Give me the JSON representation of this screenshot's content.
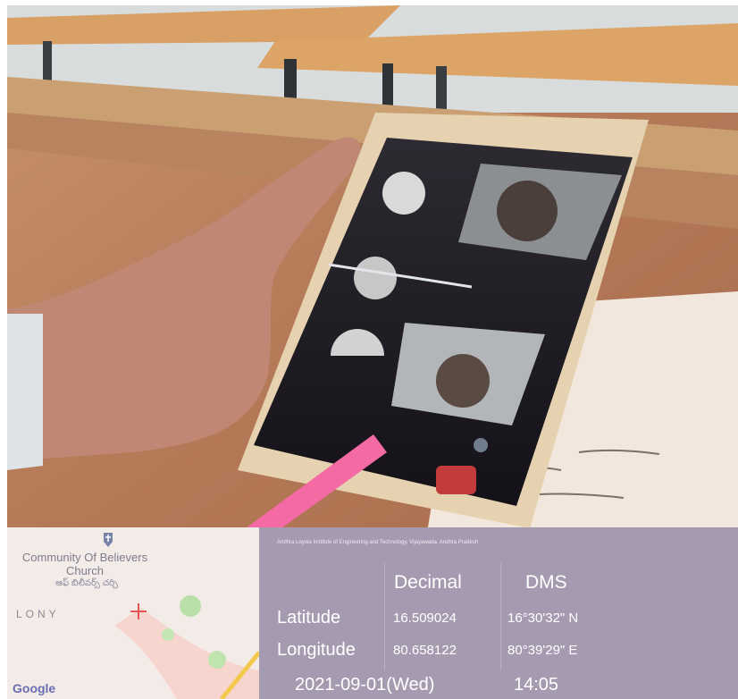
{
  "map": {
    "poi_name": "Community Of Believers Church",
    "poi_local_name": "ఆఫ్ బిలీవర్స్ చర్చి",
    "area_label": "LONY",
    "logo": "Google",
    "pin_icon": "church-pin-icon",
    "marker_icon": "crosshair-icon"
  },
  "panel": {
    "address": "Andhra Loyola Institute of Engineering and Technology, Vijayawada, Andhra Pradesh",
    "decimal_header": "Decimal",
    "dms_header": "DMS",
    "latitude_label": "Latitude",
    "longitude_label": "Longitude",
    "latitude_decimal": "16.509024",
    "latitude_dms": "16°30'32\" N",
    "longitude_decimal": "80.658122",
    "longitude_dms": "80°39'29\" E",
    "date": "2021-09-01(Wed)",
    "time": "14:05"
  },
  "colors": {
    "panel_bg": "#a69ab0",
    "map_bg": "#f3ebe7",
    "pen": "#f46aa4"
  }
}
